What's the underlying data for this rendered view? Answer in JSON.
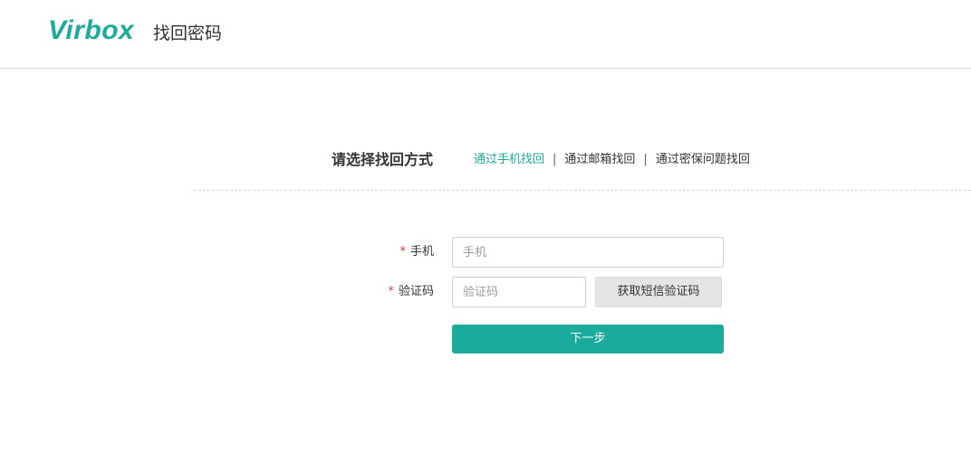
{
  "header": {
    "logo_text": "Virbox",
    "title": "找回密码"
  },
  "recovery": {
    "label": "请选择找回方式",
    "methods": [
      {
        "label": "通过手机找回",
        "active": true
      },
      {
        "label": "通过邮箱找回",
        "active": false
      },
      {
        "label": "通过密保问题找回",
        "active": false
      }
    ],
    "separator": "|"
  },
  "form": {
    "required_mark": "*",
    "phone": {
      "label": "手机",
      "placeholder": "手机",
      "value": ""
    },
    "code": {
      "label": "验证码",
      "placeholder": "验证码",
      "value": ""
    },
    "sms_button_label": "获取短信验证码",
    "next_button_label": "下一步"
  },
  "colors": {
    "accent": "#1aab9b",
    "required": "#e0362c",
    "button_gray": "#e5e5e5"
  }
}
